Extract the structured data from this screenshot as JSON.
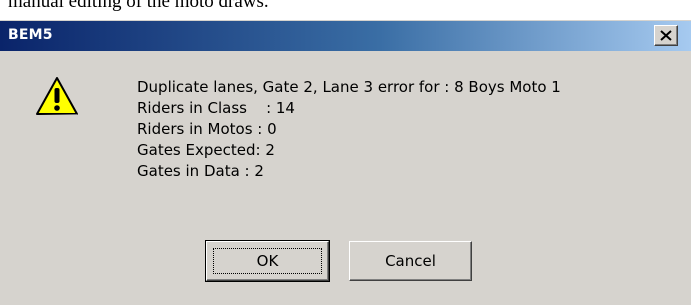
{
  "document": {
    "fragment_text": "manual editing of the moto draws."
  },
  "dialog": {
    "title": "BEM5",
    "close_label": "×",
    "icon": "warning-icon",
    "message_lines": [
      "Duplicate lanes, Gate 2, Lane 3 error for : 8 Boys Moto 1",
      "Riders in Class    : 14",
      "Riders in Motos : 0",
      "Gates Expected: 2",
      "Gates in Data : 2"
    ],
    "buttons": {
      "ok_label": "OK",
      "cancel_label": "Cancel"
    }
  },
  "colors": {
    "titlebar_start": "#0a246a",
    "titlebar_end": "#a6caf0",
    "dialog_face": "#d6d3ce",
    "warning_fill": "#ffff00"
  }
}
